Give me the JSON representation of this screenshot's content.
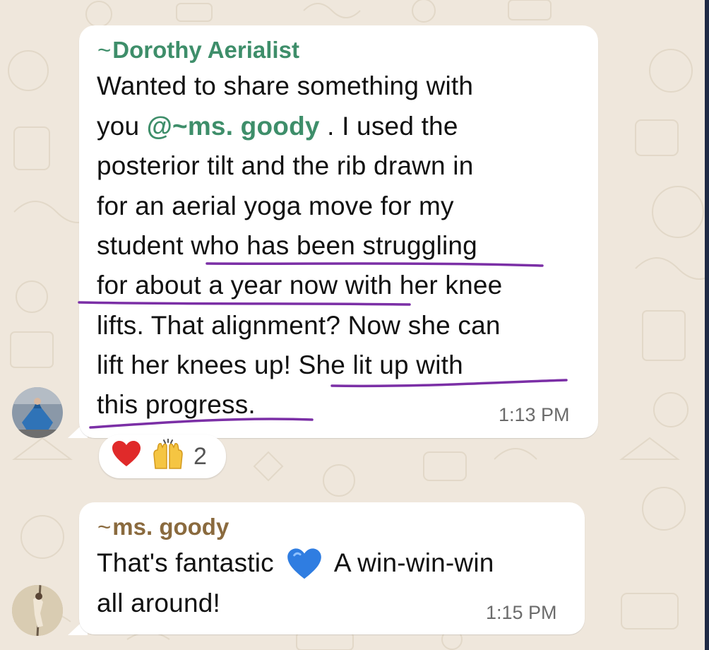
{
  "messages": [
    {
      "sender": "Dorothy Aerialist",
      "sender_prefix": "~",
      "sender_color": "#3e8e6a",
      "lines": [
        "Wanted to share something with",
        "you",
        "@~ms. goody",
        ".  I used the",
        "posterior tilt and the rib drawn in",
        "for an aerial yoga move for my",
        "student who has been struggling",
        "for about a year now with her knee",
        "lifts.  That alignment?  Now she can",
        "lift her knees up!  She lit up with",
        "this progress."
      ],
      "time": "1:13 PM",
      "reactions": {
        "emoji": [
          "❤️",
          "🙌"
        ],
        "count": "2"
      },
      "highlight_color": "#7b2fa6"
    },
    {
      "sender": "ms. goody",
      "sender_prefix": "~",
      "sender_color": "#8a6a3e",
      "lines": [
        "That's fantastic",
        "A win-win-win",
        "all around!"
      ],
      "emoji_name": "blue-heart-icon",
      "time": "1:15 PM"
    }
  ]
}
